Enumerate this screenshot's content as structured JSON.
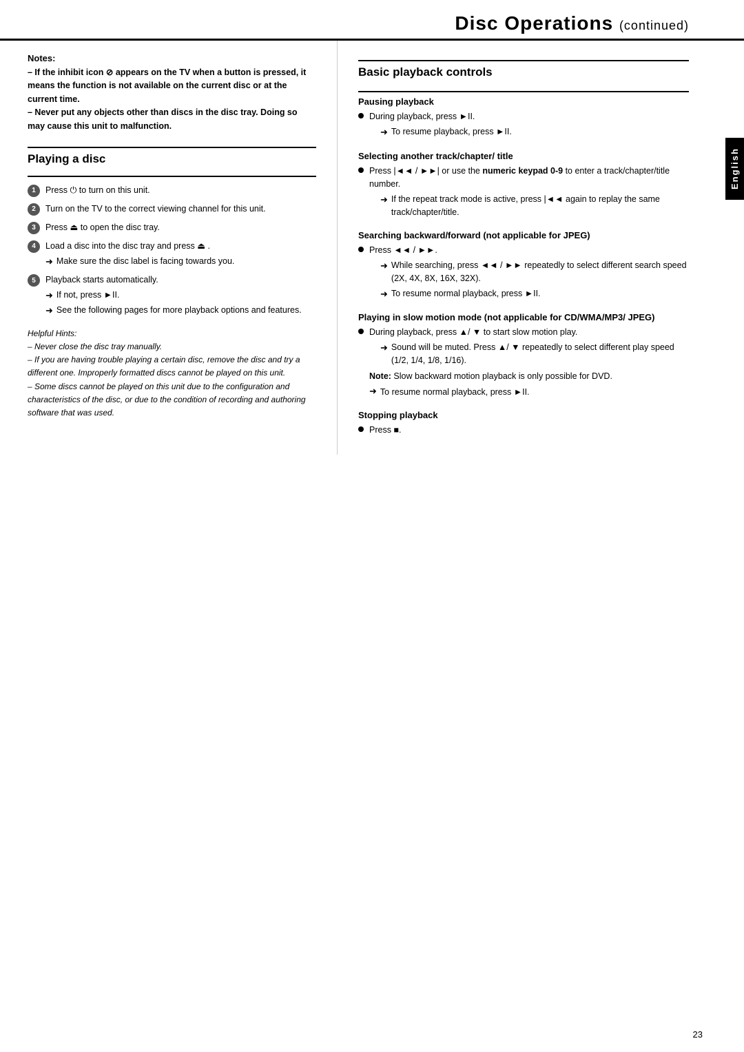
{
  "header": {
    "title": "Disc Operations",
    "continued": "(continued)"
  },
  "side_tab": {
    "label": "English"
  },
  "left_col": {
    "notes_title": "Notes:",
    "notes_lines": [
      "– If the inhibit icon ⊘ appears on the TV when a button is pressed, it means the function is not available on the current disc or at the current time.",
      "– Never put any objects other than discs in the disc tray. Doing so may cause this unit to malfunction."
    ],
    "playing_disc_heading": "Playing a disc",
    "steps": [
      {
        "num": "1",
        "text": "Press ⏻ to turn on this unit."
      },
      {
        "num": "2",
        "text": "Turn on the TV to the correct viewing channel for this unit."
      },
      {
        "num": "3",
        "text": "Press ⏏ to open the disc tray."
      },
      {
        "num": "4",
        "text": "Load a disc into the disc tray and press ⏏ .",
        "arrow": "Make sure the disc label is facing towards you."
      },
      {
        "num": "5",
        "text": "Playback starts automatically.",
        "arrows": [
          "If not, press ►II.",
          "See the following pages for more playback options and features."
        ]
      }
    ],
    "helpful_hints_title": "Helpful Hints:",
    "helpful_hints": [
      "– Never close the disc tray manually.",
      "– If you are having trouble playing a certain disc, remove the disc and try a different one. Improperly formatted discs cannot be played on this unit.",
      "– Some discs cannot be played on this unit due to the configuration and characteristics of the disc, or due to the condition of recording and authoring software that was used."
    ]
  },
  "right_col": {
    "heading": "Basic playback controls",
    "sections": [
      {
        "id": "pausing",
        "heading": "Pausing playback",
        "bullets": [
          {
            "text": "During playback, press ►II.",
            "arrows": [
              "To resume playback, press ►II."
            ]
          }
        ]
      },
      {
        "id": "selecting",
        "heading": "Selecting another track/chapter/ title",
        "bullets": [
          {
            "text": "Press |◄◄ / ►►| or use the numeric keypad 0-9 to enter a track/chapter/title number.",
            "arrows": [
              "If the repeat track mode is active, press |◄◄ again to replay the same track/chapter/title."
            ]
          }
        ]
      },
      {
        "id": "searching",
        "heading": "Searching backward/forward (not applicable for JPEG)",
        "bullets": [
          {
            "text": "Press ◄◄ / ►►.",
            "arrows": [
              "While searching, press ◄◄ / ►► repeatedly to select different search speed (2X, 4X, 8X, 16X, 32X).",
              "To resume normal playback, press ►II."
            ]
          }
        ]
      },
      {
        "id": "slow_motion",
        "heading": "Playing in slow motion mode (not applicable for CD/WMA/MP3/ JPEG)",
        "bullets": [
          {
            "text": "During playback, press ▲/ ▼ to start slow motion play.",
            "arrows": [
              "Sound will be muted. Press ▲/ ▼ repeatedly to select different play speed (1/2, 1/4, 1/8, 1/16)."
            ]
          }
        ],
        "note": "Note: Slow backward motion playback is only possible for DVD.",
        "extra_arrows": [
          "To resume normal playback, press ►II."
        ]
      },
      {
        "id": "stopping",
        "heading": "Stopping playback",
        "bullets": [
          {
            "text": "Press ■.",
            "arrows": []
          }
        ]
      }
    ]
  },
  "page_number": "23"
}
